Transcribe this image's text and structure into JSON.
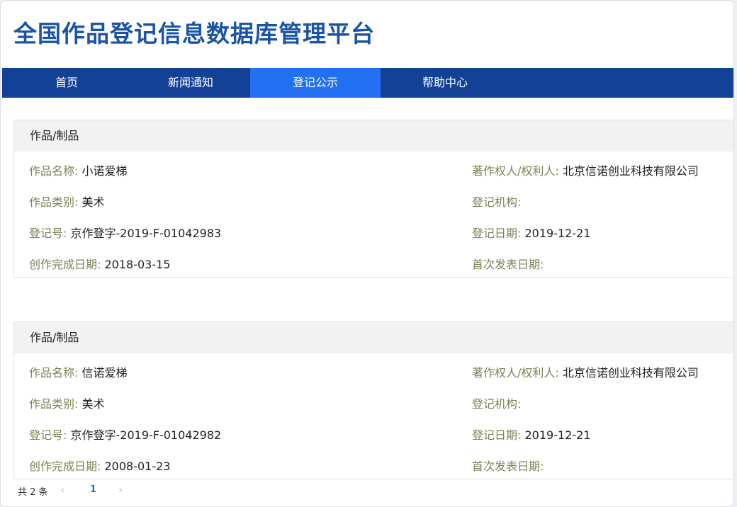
{
  "header": {
    "title": "全国作品登记信息数据库管理平台"
  },
  "nav": [
    {
      "label": "首页"
    },
    {
      "label": "新闻通知"
    },
    {
      "label": "登记公示",
      "active": true
    },
    {
      "label": "帮助中心"
    }
  ],
  "records": [
    {
      "category": "作品/制品",
      "name_label": "作品名称:",
      "name": "小诺爱梯",
      "type_label": "作品类别:",
      "type": "美术",
      "reg_no_label": "登记号:",
      "reg_no": "京作登字-2019-F-01042983",
      "created_label": "创作完成日期:",
      "created": "2018-03-15",
      "owner_label": "著作权人/权利人:",
      "owner": "北京信诺创业科技有限公司",
      "agency_label": "登记机构:",
      "agency": "",
      "reg_date_label": "登记日期:",
      "reg_date": "2019-12-21",
      "publish_label": "首次发表日期:",
      "publish": ""
    },
    {
      "category": "作品/制品",
      "name_label": "作品名称:",
      "name": "信诺爱梯",
      "type_label": "作品类别:",
      "type": "美术",
      "reg_no_label": "登记号:",
      "reg_no": "京作登字-2019-F-01042982",
      "created_label": "创作完成日期:",
      "created": "2008-01-23",
      "owner_label": "著作权人/权利人:",
      "owner": "北京信诺创业科技有限公司",
      "agency_label": "登记机构:",
      "agency": "",
      "reg_date_label": "登记日期:",
      "reg_date": "2019-12-21",
      "publish_label": "首次发表日期:",
      "publish": ""
    }
  ],
  "pagination": {
    "total_text": "共 2 条",
    "prev": "‹",
    "current_page": "1",
    "next": "›"
  },
  "colors": {
    "nav_bg": "#134197",
    "nav_active": "#2370f2",
    "title": "#1a54a8",
    "label": "#7b8355"
  }
}
